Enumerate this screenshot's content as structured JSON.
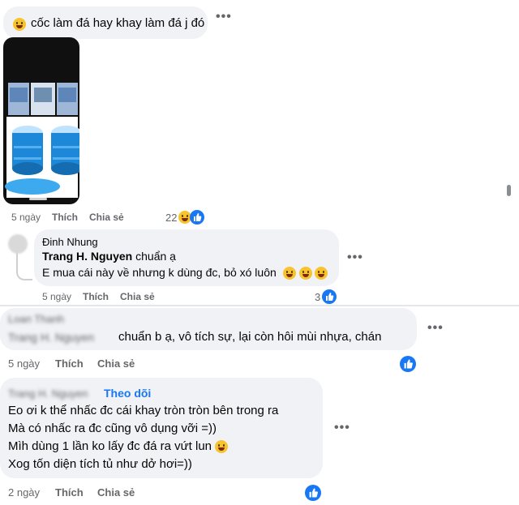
{
  "comment1": {
    "text": "cốc làm đá hay khay làm đá j đó",
    "time": "5 ngày",
    "like_label": "Thích",
    "share_label": "Chia sẻ",
    "reaction_count": "22",
    "more": "•••"
  },
  "reply1": {
    "author": "Đinh Nhung",
    "mention": "Trang H. Nguyen",
    "text_after_mention": " chuẩn ạ",
    "line2": "E mua cái này về nhưng k dùng đc, bỏ xó luôn",
    "time": "5 ngày",
    "like_label": "Thích",
    "share_label": "Chia sẻ",
    "reaction_count": "3",
    "more": "•••"
  },
  "comment2": {
    "author_blurred": "Loan Thanh",
    "mention_blurred": "Trang H. Nguyen",
    "text": "chuẩn b ạ, vô tích sự, lại còn hôi mùi nhựa, chán",
    "time": "5 ngày",
    "like_label": "Thích",
    "share_label": "Chia sẻ",
    "more": "•••"
  },
  "comment3": {
    "author_blurred": "Trang H. Nguyen",
    "follow_label": "Theo dõi",
    "lines": [
      "Eo ơi k thể nhấc đc cái khay tròn tròn bên trong ra",
      "Mà có nhấc ra đc cũng vô dụng vỡi =))",
      "Mìh dùng 1 lần ko lấy đc đá ra vứt lun",
      "Xog tốn diện tích tủ như dở hơi=))"
    ],
    "time": "2 ngày",
    "like_label": "Thích",
    "share_label": "Chia sẻ",
    "more": "•••"
  },
  "colors": {
    "bubble": "#f0f2f5",
    "accent": "#1877f2",
    "meta": "#65676b"
  }
}
